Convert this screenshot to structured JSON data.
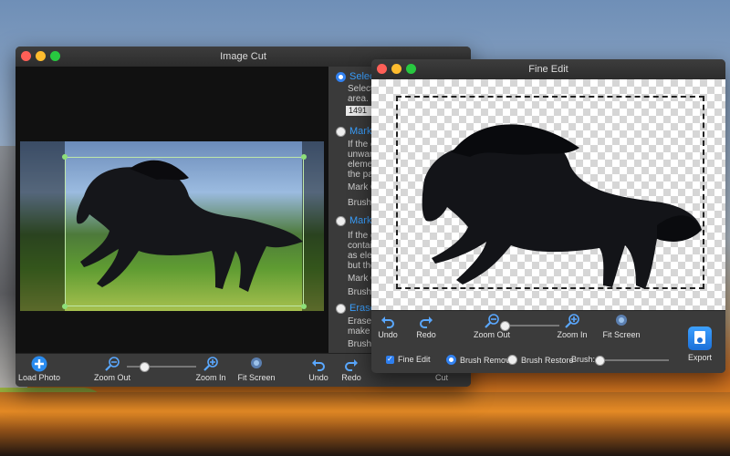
{
  "desktop": {
    "accent": "#e28620"
  },
  "cut_window": {
    "title": "Image Cut",
    "panel": {
      "option1": {
        "label": "Select",
        "desc1": "Select t",
        "desc2": "area.",
        "value": "1491"
      },
      "option2": {
        "label": "Mark t",
        "desc1": "If the ex",
        "desc2": "unwant",
        "desc3": "elemen",
        "desc4": "the par",
        "mark": "Mark C",
        "brush": "Brush:"
      },
      "option3": {
        "label": "Mark t",
        "desc1": "If the ex",
        "desc2": "contain",
        "desc3": "as elem",
        "desc4": "but the",
        "mark": "Mark C",
        "brush": "Brush:"
      },
      "option4": {
        "label": "Erase",
        "desc1": "Erase s",
        "desc2": "make it",
        "brush": "Brush:"
      }
    },
    "toolbar": {
      "load": "Load Photo",
      "zoom_out": "Zoom Out",
      "zoom_in": "Zoom In",
      "fit": "Fit Screen",
      "undo": "Undo",
      "redo": "Redo",
      "cut": "Cut",
      "zoom_level": 0.25
    }
  },
  "fine_window": {
    "title": "Fine Edit",
    "toolbar": {
      "undo": "Undo",
      "redo": "Redo",
      "zoom_out": "Zoom Out",
      "zoom_in": "Zoom In",
      "fit": "Fit Screen",
      "export": "Export",
      "fine_edit": "Fine Edit",
      "brush_remove": "Brush Remove",
      "brush_restore": "Brush Restore",
      "brush": "Brush:",
      "zoom_level": 0.0,
      "brush_level": 0.05
    }
  }
}
